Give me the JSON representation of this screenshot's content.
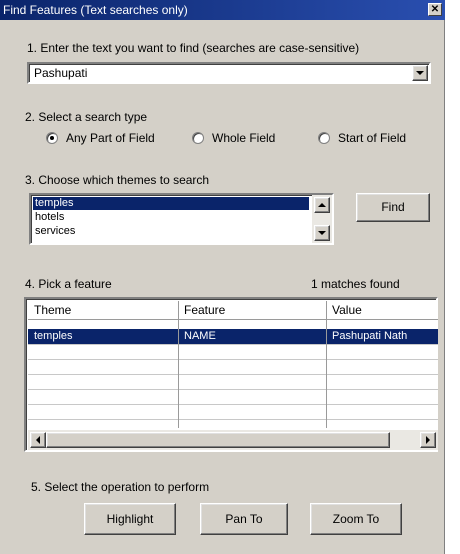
{
  "window": {
    "title": "Find Features (Text searches only)"
  },
  "step1": {
    "label": "1. Enter the text you want to find (searches are case-sensitive)",
    "value": "Pashupati"
  },
  "step2": {
    "label": "2. Select a search type",
    "options": [
      {
        "label": "Any Part of Field",
        "checked": true
      },
      {
        "label": "Whole Field",
        "checked": false
      },
      {
        "label": "Start of Field",
        "checked": false
      }
    ]
  },
  "step3": {
    "label": "3. Choose which themes to search",
    "themes": [
      "temples",
      "hotels",
      "services"
    ],
    "selected": "temples",
    "find_label": "Find"
  },
  "step4": {
    "label": "4. Pick a feature",
    "matches": "1 matches found",
    "columns": [
      "Theme",
      "Feature",
      "Value"
    ],
    "rows": [
      [
        "temples",
        "NAME",
        "Pashupati Nath"
      ]
    ]
  },
  "step5": {
    "label": "5. Select the operation to perform",
    "buttons": [
      "Highlight",
      "Pan To",
      "Zoom To"
    ]
  },
  "colors": {
    "selection": "#0a246a",
    "title_bar": "#0a246a",
    "face": "#d4d0c8"
  }
}
